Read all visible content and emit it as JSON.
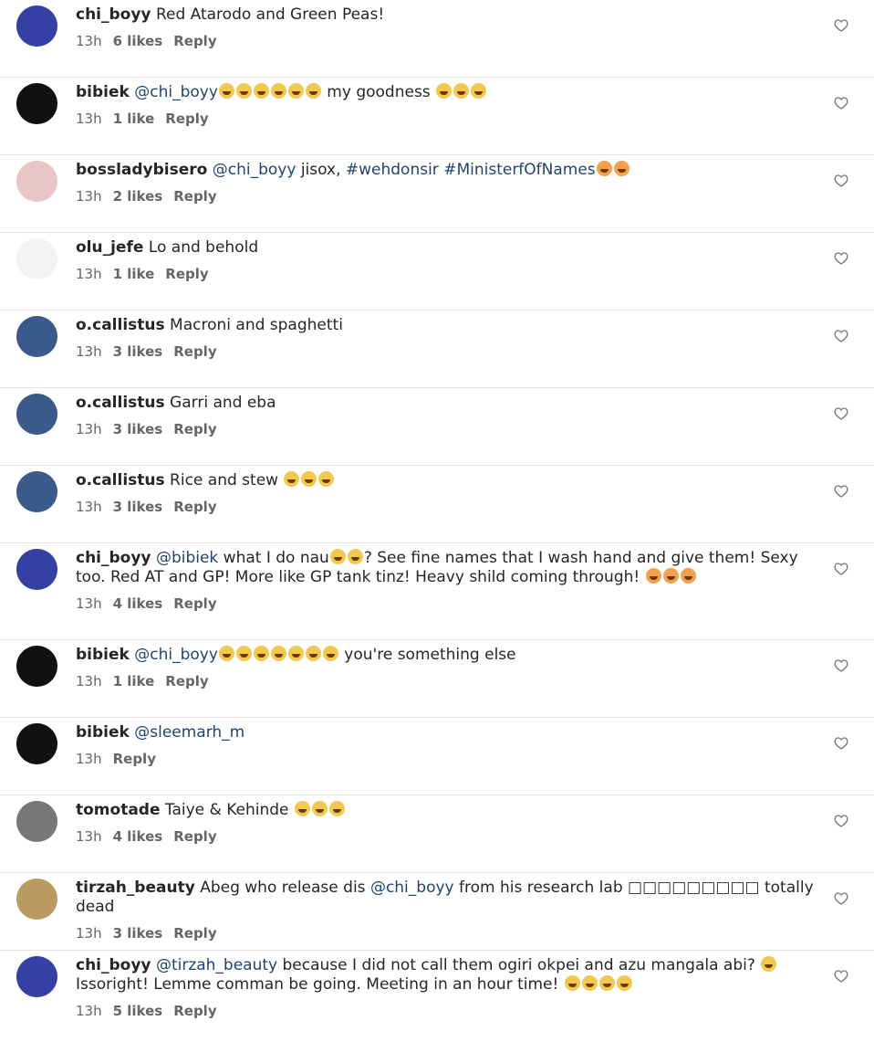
{
  "comments": [
    {
      "user": "chi_boyy",
      "parts": [
        {
          "t": "Red Atarodo and Green Peas!"
        }
      ],
      "time": "13h",
      "likes": "6 likes",
      "reply": "Reply",
      "avatar_color": "#3440a3"
    },
    {
      "user": "bibiek",
      "parts": [
        {
          "m": "@chi_boyy"
        },
        {
          "e": 6
        },
        {
          "t": " my goodness "
        },
        {
          "e": 3
        }
      ],
      "time": "13h",
      "likes": "1 like",
      "reply": "Reply",
      "avatar_color": "#111"
    },
    {
      "user": "bossladybisero",
      "parts": [
        {
          "m": "@chi_boyy"
        },
        {
          "t": " jisox, "
        },
        {
          "m": "#wehdonsir"
        },
        {
          "t": "  "
        },
        {
          "m": "#MinisterfOfNames"
        },
        {
          "f": 2
        }
      ],
      "time": "13h",
      "likes": "2 likes",
      "reply": "Reply",
      "avatar_color": "#e8c6c6"
    },
    {
      "user": "olu_jefe",
      "parts": [
        {
          "t": "Lo and behold"
        }
      ],
      "time": "13h",
      "likes": "1 like",
      "reply": "Reply",
      "avatar_color": "#f3f3f3"
    },
    {
      "user": "o.callistus",
      "parts": [
        {
          "t": "Macroni and spaghetti"
        }
      ],
      "time": "13h",
      "likes": "3 likes",
      "reply": "Reply",
      "avatar_color": "#3b5a8c"
    },
    {
      "user": "o.callistus",
      "parts": [
        {
          "t": "Garri and eba"
        }
      ],
      "time": "13h",
      "likes": "3 likes",
      "reply": "Reply",
      "avatar_color": "#3b5a8c"
    },
    {
      "user": "o.callistus",
      "parts": [
        {
          "t": "Rice and stew "
        },
        {
          "e": 3
        }
      ],
      "time": "13h",
      "likes": "3 likes",
      "reply": "Reply",
      "avatar_color": "#3b5a8c"
    },
    {
      "user": "chi_boyy",
      "parts": [
        {
          "m": "@bibiek"
        },
        {
          "t": " what I do nau"
        },
        {
          "s": 2
        },
        {
          "t": "? See fine names that I wash hand and give them! Sexy too. Red AT and GP! More like GP tank tinz! Heavy shild coming through! "
        },
        {
          "f": 3
        }
      ],
      "time": "13h",
      "likes": "4 likes",
      "reply": "Reply",
      "avatar_color": "#3440a3",
      "tall": true
    },
    {
      "user": "bibiek",
      "parts": [
        {
          "m": "@chi_boyy"
        },
        {
          "e": 7
        },
        {
          "t": " you're something else"
        }
      ],
      "time": "13h",
      "likes": "1 like",
      "reply": "Reply",
      "avatar_color": "#111"
    },
    {
      "user": "bibiek",
      "parts": [
        {
          "m": "@sleemarh_m"
        }
      ],
      "time": "13h",
      "likes": "",
      "reply": "Reply",
      "avatar_color": "#111"
    },
    {
      "user": "tomotade",
      "parts": [
        {
          "t": "Taiye & Kehinde "
        },
        {
          "e": 3
        }
      ],
      "time": "13h",
      "likes": "4 likes",
      "reply": "Reply",
      "avatar_color": "#777"
    },
    {
      "user": "tirzah_beauty",
      "parts": [
        {
          "t": "Abeg who release dis "
        },
        {
          "m": "@chi_boyy"
        },
        {
          "t": " from his research lab □□□□□□□□□ totally dead"
        }
      ],
      "time": "13h",
      "likes": "3 likes",
      "reply": "Reply",
      "avatar_color": "#b99b62"
    },
    {
      "user": "chi_boyy",
      "parts": [
        {
          "m": "@tirzah_beauty"
        },
        {
          "t": " because I did not call them ogiri okpei and azu mangala abi? "
        },
        {
          "s": 1
        },
        {
          "t": " Issoright! Lemme comman be going. Meeting in an hour time! "
        },
        {
          "e": 4
        }
      ],
      "time": "13h",
      "likes": "5 likes",
      "reply": "Reply",
      "avatar_color": "#3440a3",
      "tall": true
    }
  ]
}
